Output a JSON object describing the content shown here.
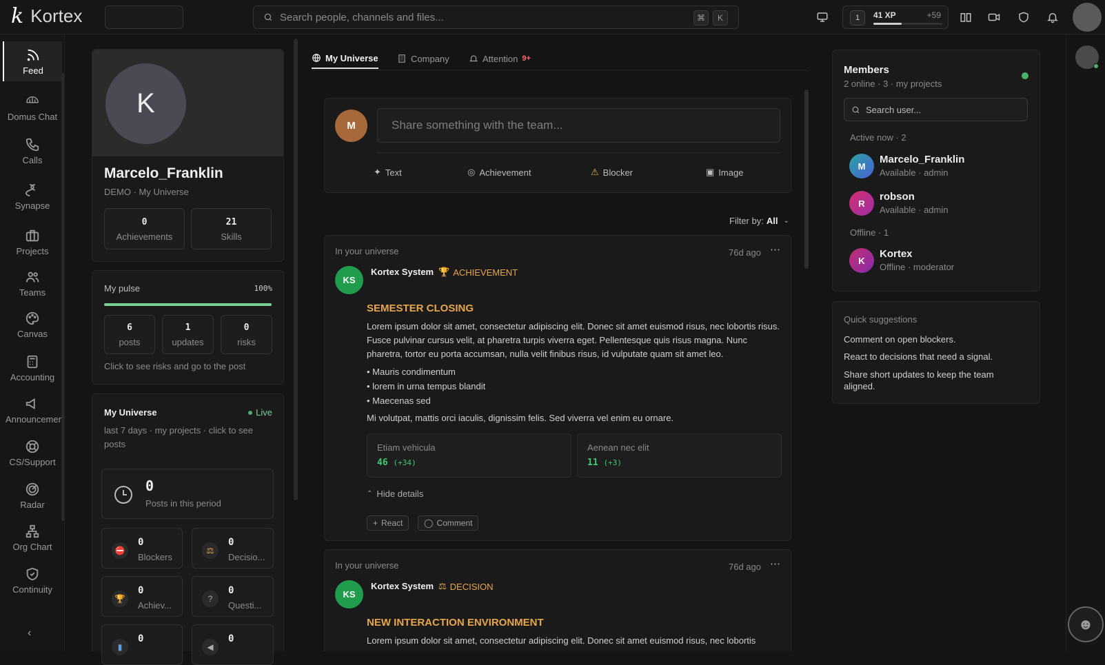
{
  "app": {
    "name": "Kortex"
  },
  "search": {
    "placeholder": "Search people, channels and files...",
    "kbd_cmd": "⌘",
    "kbd_key": "K"
  },
  "xp": {
    "level": "1",
    "label": "41 XP",
    "gain": "+59",
    "progress": 0.41
  },
  "nav": [
    {
      "label": "Feed",
      "icon": "rss-icon",
      "active": true
    },
    {
      "label": "Domus Chat",
      "icon": "domus-icon"
    },
    {
      "label": "Calls",
      "icon": "phone-icon"
    },
    {
      "label": "Synapse",
      "icon": "synapse-icon"
    },
    {
      "label": "Projects",
      "icon": "briefcase-icon"
    },
    {
      "label": "Teams",
      "icon": "users-icon"
    },
    {
      "label": "Canvas",
      "icon": "palette-icon"
    },
    {
      "label": "Accounting",
      "icon": "calculator-icon"
    },
    {
      "label": "Announcements",
      "icon": "megaphone-icon"
    },
    {
      "label": "CS/Support",
      "icon": "lifebuoy-icon"
    },
    {
      "label": "Radar",
      "icon": "radar-icon"
    },
    {
      "label": "Org Chart",
      "icon": "orgchart-icon"
    },
    {
      "label": "Continuity",
      "icon": "shield-check-icon"
    }
  ],
  "profile": {
    "initial": "K",
    "name": "Marcelo_Franklin",
    "subtitle": "DEMO · My Universe",
    "achievements_value": "0",
    "achievements_label": "Achievements",
    "skills_value": "21",
    "skills_label": "Skills"
  },
  "pulse": {
    "title": "My pulse",
    "percent": "100%",
    "progress": 1.0,
    "posts_value": "6",
    "posts_label": "posts",
    "updates_value": "1",
    "updates_label": "updates",
    "risks_value": "0",
    "risks_label": "risks",
    "hint": "Click to see risks and go to the post"
  },
  "universe_card": {
    "title": "My Universe",
    "live": "Live",
    "desc": "last 7 days · my projects · click to see posts",
    "period_value": "0",
    "period_label": "Posts in this period",
    "blockers_value": "0",
    "blockers_label": "Blockers",
    "decisions_value": "0",
    "decisions_label": "Decisio...",
    "achiev_value": "0",
    "achiev_label": "Achiev...",
    "questions_value": "0",
    "questions_label": "Questi...",
    "extra1_value": "0",
    "extra2_value": "0"
  },
  "tabs": [
    {
      "label": "My Universe",
      "active": true
    },
    {
      "label": "Company"
    },
    {
      "label": "Attention",
      "badge": "9+"
    }
  ],
  "composer": {
    "initial": "M",
    "placeholder": "Share something with the team...",
    "actions": [
      "Text",
      "Achievement",
      "Blocker",
      "Image"
    ]
  },
  "filter": {
    "label": "Filter by:",
    "value": "All"
  },
  "posts": [
    {
      "context": "In your universe",
      "time": "76d ago",
      "author_initials": "KS",
      "author": "Kortex System",
      "type": "ACHIEVEMENT",
      "title": "SEMESTER CLOSING",
      "body": "Lorem ipsum dolor sit amet, consectetur adipiscing elit. Donec sit amet euismod risus, nec lobortis risus. Fusce pulvinar cursus velit, at pharetra turpis viverra eget. Pellentesque quis risus magna. Nunc pharetra, tortor eu porta accumsan, nulla velit finibus risus, id vulputate quam sit amet leo.",
      "bullets": [
        "Mauris condimentum",
        "lorem in urna tempus blandit",
        "Maecenas sed"
      ],
      "footer": "Mi volutpat, mattis orci iaculis, dignissim felis. Sed viverra vel enim eu ornare.",
      "metrics": [
        {
          "label": "Etiam vehicula",
          "value": "46",
          "delta": "(+34)"
        },
        {
          "label": "Aenean nec elit",
          "value": "11",
          "delta": "(+3)"
        }
      ],
      "hide_details": "Hide details",
      "react": "React",
      "comment": "Comment"
    },
    {
      "context": "In your universe",
      "time": "76d ago",
      "author_initials": "KS",
      "author": "Kortex System",
      "type": "DECISION",
      "title": "NEW INTERACTION ENVIRONMENT",
      "body": "Lorem ipsum dolor sit amet, consectetur adipiscing elit. Donec sit amet euismod risus, nec lobortis"
    }
  ],
  "members": {
    "title": "Members",
    "subtitle": "2 online · 3 · my projects",
    "search_placeholder": "Search user...",
    "active_label": "Active now · 2",
    "offline_label": "Offline · 1",
    "list": [
      {
        "initial": "M",
        "name": "Marcelo_Franklin",
        "status": "Available · admin",
        "color": "#3a7bd5"
      },
      {
        "initial": "R",
        "name": "robson",
        "status": "Available · admin",
        "color": "#c2366e"
      },
      {
        "initial": "K",
        "name": "Kortex",
        "status": "Offline · moderator",
        "color": "#a0309a"
      }
    ]
  },
  "suggestions": {
    "title": "Quick suggestions",
    "items": [
      "Comment on open blockers.",
      "React to decisions that need a signal.",
      "Share short updates to keep the team aligned."
    ]
  },
  "colors": {
    "accent_green": "#3ccb6f",
    "accent_orange": "#e8a64a",
    "online_dot": "#4caf6a"
  }
}
